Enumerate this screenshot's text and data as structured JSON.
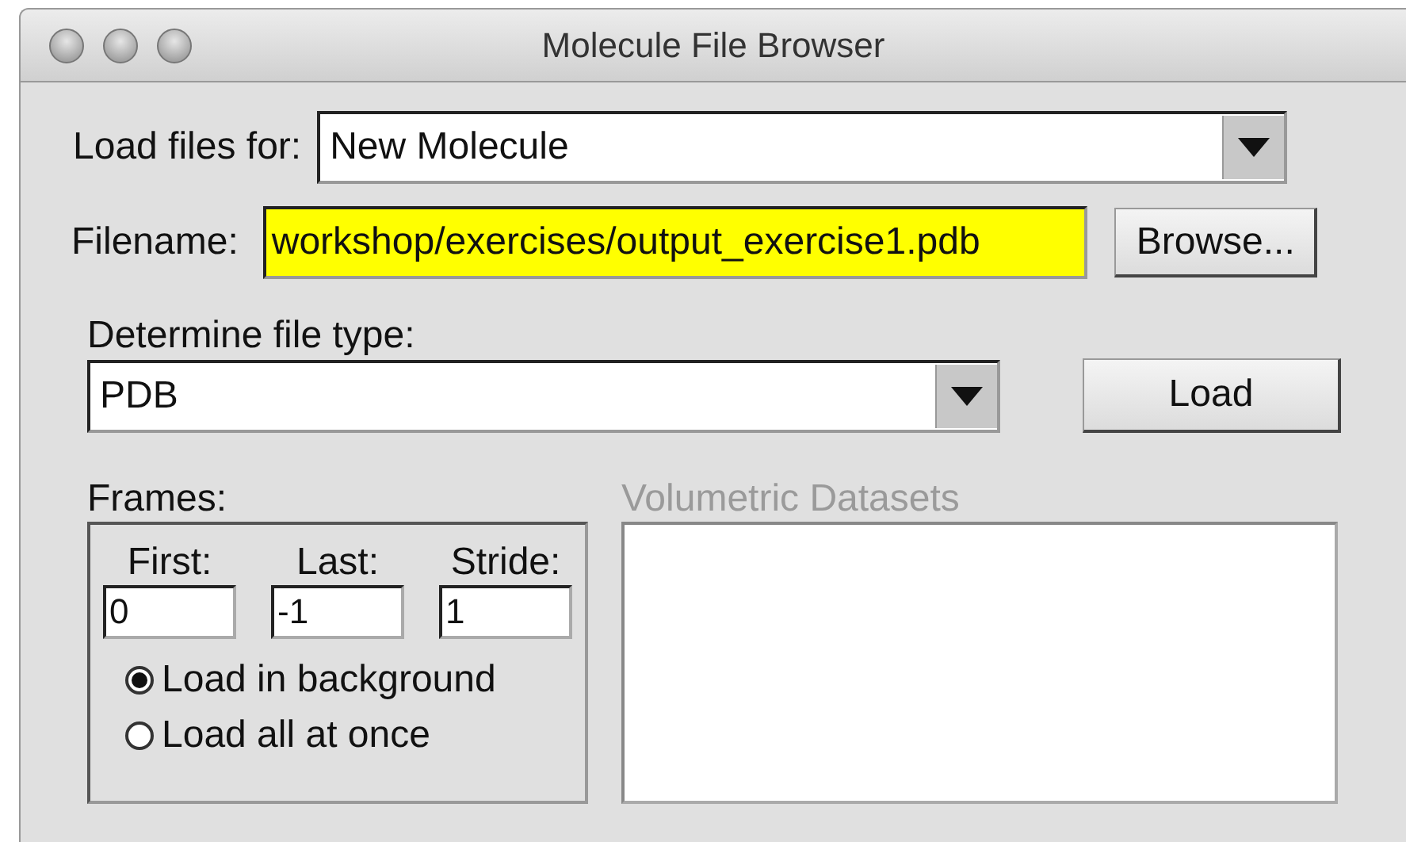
{
  "window": {
    "title": "Molecule File Browser"
  },
  "load_files_for": {
    "label": "Load files for:",
    "value": "New Molecule"
  },
  "filename": {
    "label": "Filename:",
    "value": "workshop/exercises/output_exercise1.pdb",
    "highlighted": true
  },
  "browse_button": "Browse...",
  "file_type": {
    "label": "Determine file type:",
    "value": "PDB"
  },
  "load_button": "Load",
  "frames": {
    "label": "Frames:",
    "fields": [
      {
        "label": "First:",
        "value": "0"
      },
      {
        "label": "Last:",
        "value": "-1"
      },
      {
        "label": "Stride:",
        "value": "1"
      }
    ],
    "options": [
      {
        "label": "Load in background",
        "selected": true
      },
      {
        "label": "Load all at once",
        "selected": false
      }
    ]
  },
  "volumetric_datasets": {
    "label": "Volumetric Datasets",
    "disabled": true
  }
}
